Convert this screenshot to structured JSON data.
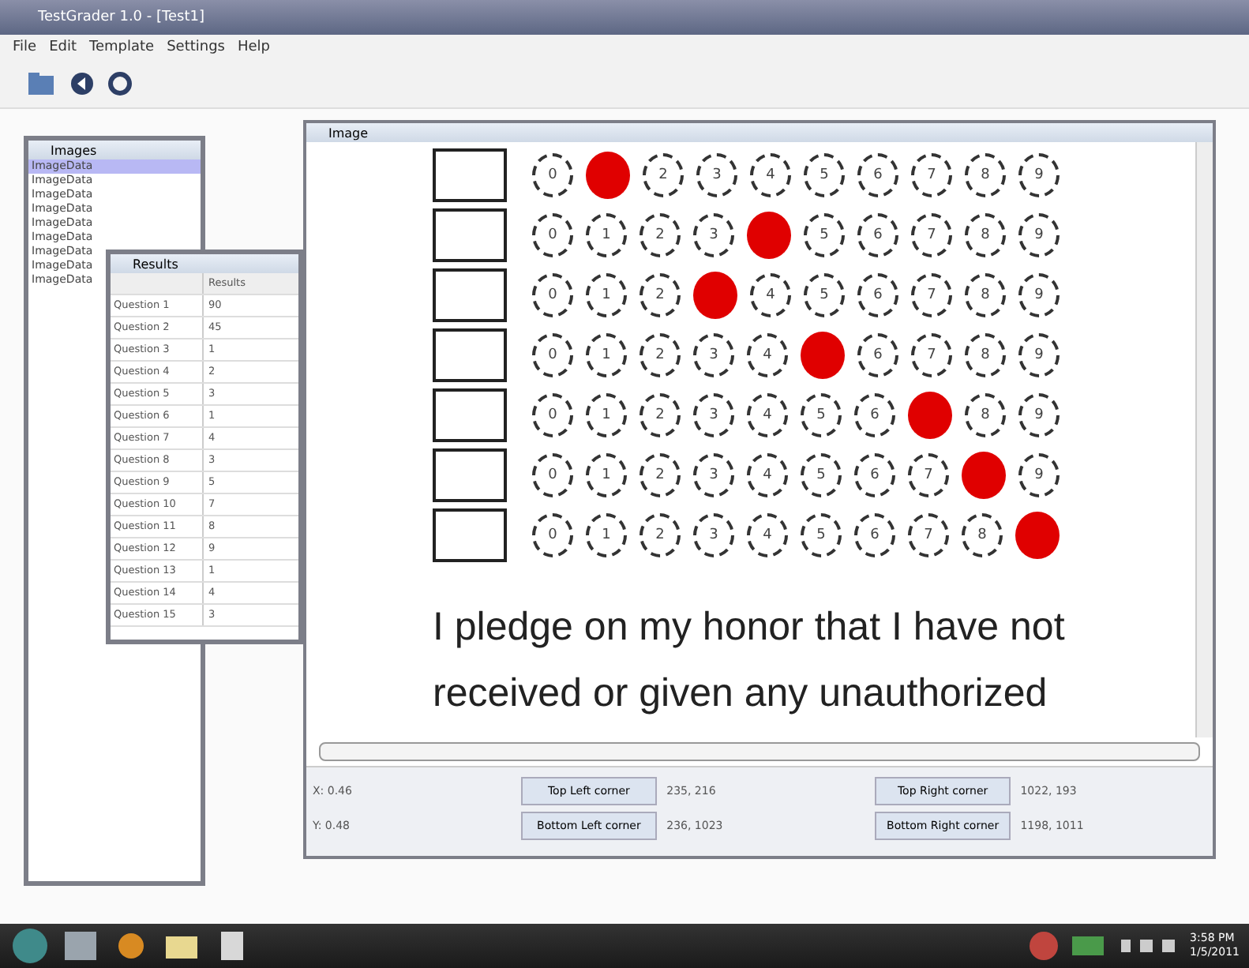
{
  "window": {
    "title": "TestGrader 1.0 - [Test1]"
  },
  "menu": [
    "File",
    "Edit",
    "Template",
    "Settings",
    "Help"
  ],
  "images_panel": {
    "title": "Images",
    "items": [
      {
        "label": "ImageData",
        "selected": true
      },
      {
        "label": "ImageData",
        "selected": false
      },
      {
        "label": "ImageData",
        "selected": false
      },
      {
        "label": "ImageData",
        "selected": false
      },
      {
        "label": "ImageData",
        "selected": false
      },
      {
        "label": "ImageData",
        "selected": false
      },
      {
        "label": "ImageData",
        "selected": false
      },
      {
        "label": "ImageData",
        "selected": false
      },
      {
        "label": "ImageData",
        "selected": false
      }
    ]
  },
  "results_panel": {
    "title": "Results",
    "column": "Results",
    "rows": [
      {
        "name": "Question 1",
        "value": "90"
      },
      {
        "name": "Question 2",
        "value": "45"
      },
      {
        "name": "Question 3",
        "value": "1"
      },
      {
        "name": "Question 4",
        "value": "2"
      },
      {
        "name": "Question 5",
        "value": "3"
      },
      {
        "name": "Question 6",
        "value": "1"
      },
      {
        "name": "Question 7",
        "value": "4"
      },
      {
        "name": "Question 8",
        "value": "3"
      },
      {
        "name": "Question 9",
        "value": "5"
      },
      {
        "name": "Question 10",
        "value": "7"
      },
      {
        "name": "Question 11",
        "value": "8"
      },
      {
        "name": "Question 12",
        "value": "9"
      },
      {
        "name": "Question 13",
        "value": "1"
      },
      {
        "name": "Question 14",
        "value": "4"
      },
      {
        "name": "Question 15",
        "value": "3"
      }
    ]
  },
  "image_window": {
    "title": "Image",
    "grid": [
      {
        "bubbles": [
          {
            "label": "0",
            "selected": false
          },
          {
            "selected": true
          },
          {
            "label": "2",
            "selected": false
          },
          {
            "label": "3",
            "selected": false
          },
          {
            "label": "4",
            "selected": false
          },
          {
            "label": "5",
            "selected": false
          },
          {
            "label": "6",
            "selected": false
          },
          {
            "label": "7",
            "selected": false
          },
          {
            "label": "8",
            "selected": false
          },
          {
            "label": "9",
            "selected": false
          }
        ]
      },
      {
        "bubbles": [
          {
            "label": "0",
            "selected": false
          },
          {
            "label": "1",
            "selected": false
          },
          {
            "label": "2",
            "selected": false
          },
          {
            "label": "3",
            "selected": false
          },
          {
            "selected": true
          },
          {
            "label": "5",
            "selected": false
          },
          {
            "label": "6",
            "selected": false
          },
          {
            "label": "7",
            "selected": false
          },
          {
            "label": "8",
            "selected": false
          },
          {
            "label": "9",
            "selected": false
          }
        ]
      },
      {
        "bubbles": [
          {
            "label": "0",
            "selected": false
          },
          {
            "label": "1",
            "selected": false
          },
          {
            "label": "2",
            "selected": false
          },
          {
            "selected": true
          },
          {
            "label": "4",
            "selected": false
          },
          {
            "label": "5",
            "selected": false
          },
          {
            "label": "6",
            "selected": false
          },
          {
            "label": "7",
            "selected": false
          },
          {
            "label": "8",
            "selected": false
          },
          {
            "label": "9",
            "selected": false
          }
        ]
      },
      {
        "bubbles": [
          {
            "label": "0",
            "selected": false
          },
          {
            "label": "1",
            "selected": false
          },
          {
            "label": "2",
            "selected": false
          },
          {
            "label": "3",
            "selected": false
          },
          {
            "label": "4",
            "selected": false
          },
          {
            "selected": true
          },
          {
            "label": "6",
            "selected": false
          },
          {
            "label": "7",
            "selected": false
          },
          {
            "label": "8",
            "selected": false
          },
          {
            "label": "9",
            "selected": false
          }
        ]
      },
      {
        "bubbles": [
          {
            "label": "0",
            "selected": false
          },
          {
            "label": "1",
            "selected": false
          },
          {
            "label": "2",
            "selected": false
          },
          {
            "label": "3",
            "selected": false
          },
          {
            "label": "4",
            "selected": false
          },
          {
            "label": "5",
            "selected": false
          },
          {
            "label": "6",
            "selected": false
          },
          {
            "selected": true
          },
          {
            "label": "8",
            "selected": false
          },
          {
            "label": "9",
            "selected": false
          }
        ]
      },
      {
        "bubbles": [
          {
            "label": "0",
            "selected": false
          },
          {
            "label": "1",
            "selected": false
          },
          {
            "label": "2",
            "selected": false
          },
          {
            "label": "3",
            "selected": false
          },
          {
            "label": "4",
            "selected": false
          },
          {
            "label": "5",
            "selected": false
          },
          {
            "label": "6",
            "selected": false
          },
          {
            "label": "7",
            "selected": false
          },
          {
            "selected": true
          },
          {
            "label": "9",
            "selected": false
          }
        ]
      },
      {
        "bubbles": [
          {
            "label": "0",
            "selected": false
          },
          {
            "label": "1",
            "selected": false
          },
          {
            "label": "2",
            "selected": false
          },
          {
            "label": "3",
            "selected": false
          },
          {
            "label": "4",
            "selected": false
          },
          {
            "label": "5",
            "selected": false
          },
          {
            "label": "6",
            "selected": false
          },
          {
            "label": "7",
            "selected": false
          },
          {
            "label": "8",
            "selected": false
          },
          {
            "selected": true
          }
        ]
      }
    ],
    "pledge": [
      "I pledge on my honor that I have not",
      "received or given any unauthorized"
    ],
    "coords": [
      {
        "axis": "X: 0.46",
        "corners": [
          {
            "button": "Top Left corner",
            "value": "235, 216"
          },
          {
            "button": "Top Right corner",
            "value": "1022, 193"
          }
        ]
      },
      {
        "axis": "Y: 0.48",
        "corners": [
          {
            "button": "Bottom Left corner",
            "value": "236, 1023"
          },
          {
            "button": "Bottom Right corner",
            "value": "1198, 1011"
          }
        ]
      }
    ]
  },
  "taskbar": {
    "clock": [
      "3:58 PM",
      "1/5/2011"
    ]
  }
}
